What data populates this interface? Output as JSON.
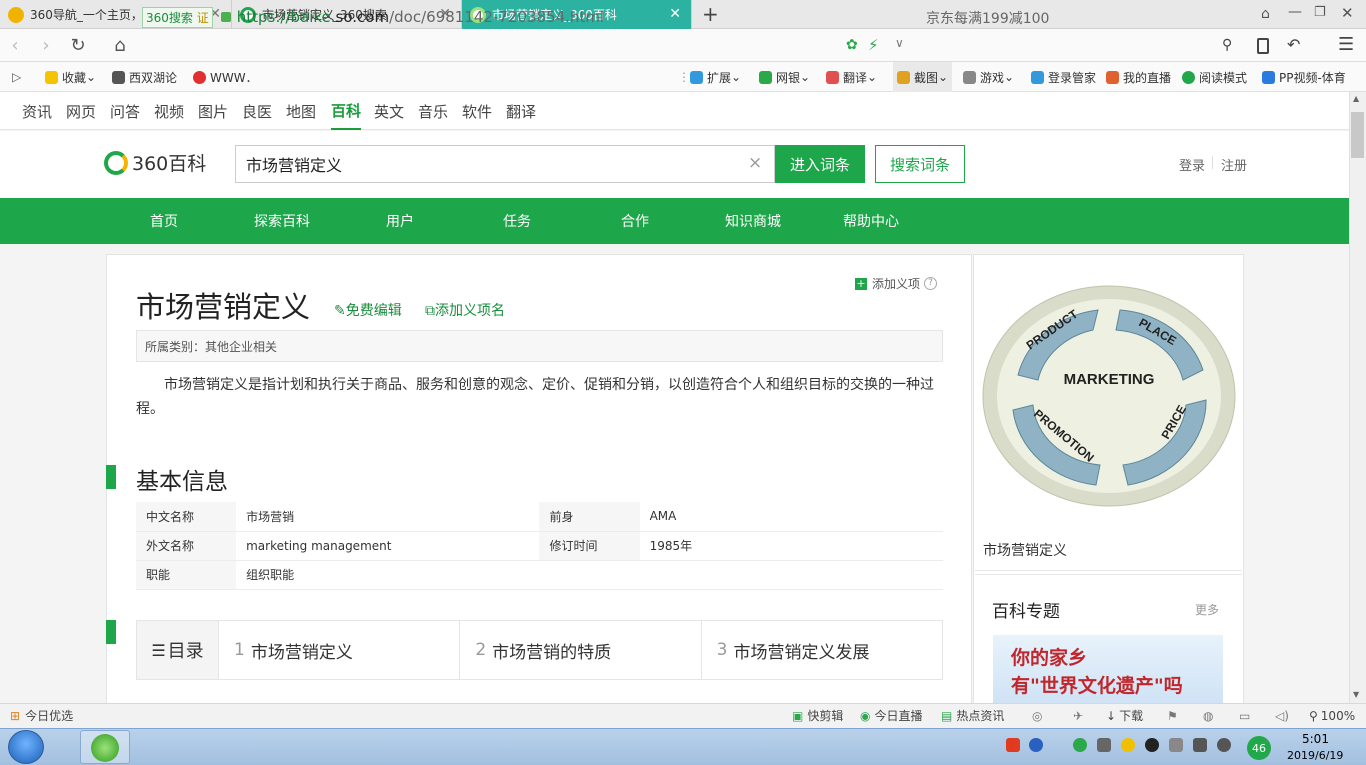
{
  "browser": {
    "tabs": [
      {
        "title": "360导航_一个主页，整个世界",
        "color": "#f0b400"
      },
      {
        "title": "市场营销定义_360搜索",
        "color": "#22a64a"
      },
      {
        "title": "市场营销定义_360百科",
        "color": "#9be27a"
      }
    ],
    "new_tab": "+",
    "url_badge": "360搜索",
    "url_badge_tag": "证",
    "url_scheme": "https://baike.",
    "url_host": "so.com",
    "url_path": "/doc/6981142-7203854.html",
    "promo": "京东每满199减100"
  },
  "bookmarks": {
    "left": [
      {
        "label": "收藏",
        "color": "#f5c400"
      },
      {
        "label": "西双湖论",
        "color": "#555555"
      },
      {
        "label": "WWW．",
        "color": "#e03030"
      }
    ],
    "right": [
      {
        "label": "扩展",
        "color": "#3399dd"
      },
      {
        "label": "网银",
        "color": "#2aa84a"
      },
      {
        "label": "翻译",
        "color": "#e05050"
      },
      {
        "label": "截图",
        "color": "#e0a020"
      },
      {
        "label": "游戏",
        "color": "#888888"
      },
      {
        "label": "登录管家",
        "color": "#3399dd"
      },
      {
        "label": "我的直播",
        "color": "#e06030"
      },
      {
        "label": "阅读模式",
        "color": "#22a64a"
      },
      {
        "label": "PP视频-体育",
        "color": "#2a7ae0"
      }
    ]
  },
  "so_nav": [
    "资讯",
    "网页",
    "问答",
    "视频",
    "图片",
    "良医",
    "地图",
    "百科",
    "英文",
    "音乐",
    "软件",
    "翻译"
  ],
  "so_nav_active": "百科",
  "header": {
    "logo": "360百科",
    "search_value": "市场营销定义",
    "clear": "×",
    "enter_button": "进入词条",
    "search_button": "搜索词条",
    "login": "登录",
    "register": "注册"
  },
  "green_nav": [
    "首页",
    "探索百科",
    "用户",
    "任务",
    "合作",
    "知识商城",
    "帮助中心"
  ],
  "article": {
    "title": "市场营销定义",
    "edit": "免费编辑",
    "add_name": "添加义项名",
    "add_term": "添加义项",
    "category": "所属类别：其他企业相关",
    "summary": "市场营销定义是指计划和执行关于商品、服务和创意的观念、定价、促销和分销，以创造符合个人和组织目标的交换的一种过程。",
    "basic_info_heading": "基本信息",
    "info_rows": [
      {
        "k1": "中文名称",
        "v1": "市场营销",
        "k2": "前身",
        "v2": "AMA"
      },
      {
        "k1": "外文名称",
        "v1": "marketing management",
        "k2": "修订时间",
        "v2": "1985年"
      },
      {
        "k1": "职能",
        "v1": "组织职能",
        "k2": "",
        "v2": ""
      }
    ],
    "toc_label": "目录",
    "toc": [
      {
        "num": "1",
        "text": "市场营销定义"
      },
      {
        "num": "2",
        "text": "市场营销的特质"
      },
      {
        "num": "3",
        "text": "市场营销定义发展"
      }
    ]
  },
  "sidebar": {
    "image_words": {
      "center": "MARKETING",
      "product": "PRODUCT",
      "place": "PLACE",
      "price": "PRICE",
      "promotion": "PROMOTION"
    },
    "caption": "市场营销定义",
    "topic_heading": "百科专题",
    "more": "更多",
    "banner_line1": "你的家乡",
    "banner_line2": "有\"世界文化遗产\"吗"
  },
  "statusbar": {
    "left": "今日优选",
    "items": [
      "快剪辑",
      "今日直播",
      "热点资讯",
      "下载",
      "100%"
    ]
  },
  "taskbar": {
    "battery": "46",
    "time": "5:01",
    "date": "2019/6/19"
  }
}
